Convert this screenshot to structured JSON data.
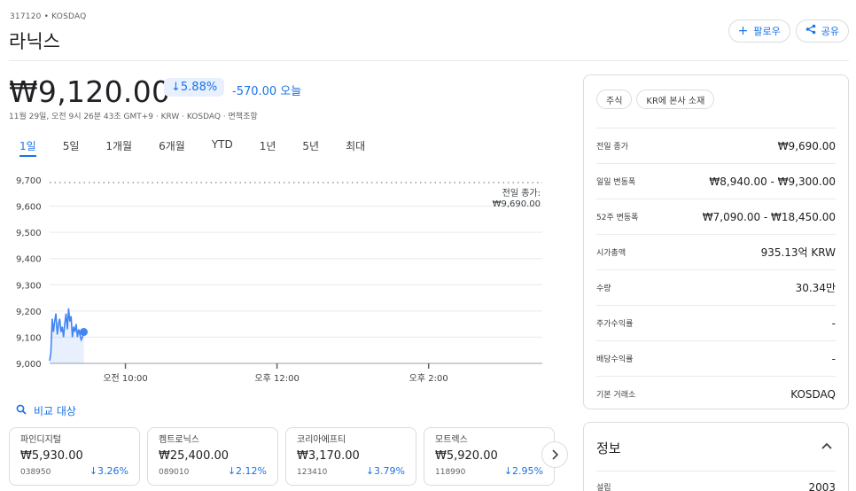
{
  "header": {
    "ticker_line": "317120 • KOSDAQ",
    "company": "라닉스",
    "follow_label": "팔로우",
    "share_label": "공유"
  },
  "quote": {
    "price": "₩9,120.00",
    "change_pct": "↓5.88%",
    "change_abs": "-570.00 오늘",
    "timestamp": "11월 29일, 오전 9시 26분 43초 GMT+9 · KRW · KOSDAQ · 면책조항"
  },
  "ranges": [
    "1일",
    "5일",
    "1개월",
    "6개월",
    "YTD",
    "1년",
    "5년",
    "최대"
  ],
  "active_range": "1일",
  "chart_data": {
    "type": "line",
    "ylim": [
      9000,
      9700
    ],
    "ytick_labels": [
      "9,700",
      "9,600",
      "9,500",
      "9,400",
      "9,300",
      "9,200",
      "9,100",
      "9,000"
    ],
    "ytick_values": [
      9700,
      9600,
      9500,
      9400,
      9300,
      9200,
      9100,
      9000
    ],
    "xtick_labels": [
      "오전 10:00",
      "오후 12:00",
      "오후 2:00"
    ],
    "xtick_minutes": [
      600,
      720,
      840
    ],
    "xlim_minutes": [
      540,
      930
    ],
    "prev_close": 9690,
    "prev_close_label": "전일 종가:",
    "prev_close_value": "₩9,690.00",
    "series": [
      {
        "x": [
          540,
          541,
          542,
          543,
          544,
          545,
          546,
          547,
          548,
          549,
          550,
          551,
          552,
          553,
          554,
          555,
          556,
          557,
          558,
          559,
          560,
          561,
          562,
          563,
          564,
          565,
          566,
          567
        ],
        "y": [
          9010,
          9040,
          9170,
          9120,
          9160,
          9190,
          9110,
          9150,
          9170,
          9120,
          9140,
          9100,
          9150,
          9190,
          9130,
          9210,
          9160,
          9180,
          9100,
          9140,
          9120,
          9150,
          9100,
          9130,
          9110,
          9090,
          9100,
          9120
        ]
      }
    ],
    "colors": {
      "line": "#4285f4",
      "grid": "#e8eaed",
      "prev_close": "#5f6368"
    }
  },
  "compare": {
    "label": "비교 대상"
  },
  "cards": [
    {
      "name": "파인디지털",
      "price": "₩5,930.00",
      "code": "038950",
      "pct": "↓3.26%"
    },
    {
      "name": "켐트로닉스",
      "price": "₩25,400.00",
      "code": "089010",
      "pct": "↓2.12%"
    },
    {
      "name": "코리아에프티",
      "price": "₩3,170.00",
      "code": "123410",
      "pct": "↓3.79%"
    },
    {
      "name": "모트렉스",
      "price": "₩5,920.00",
      "code": "118990",
      "pct": "↓2.95%"
    }
  ],
  "tags": [
    "주식",
    "KR에 본사 소재"
  ],
  "stats": [
    {
      "label": "전일 종가",
      "value": "₩9,690.00"
    },
    {
      "label": "일일 변동폭",
      "value": "₩8,940.00 - ₩9,300.00"
    },
    {
      "label": "52주 변동폭",
      "value": "₩7,090.00 - ₩18,450.00"
    },
    {
      "label": "시가총액",
      "value": "935.13억 KRW"
    },
    {
      "label": "수량",
      "value": "30.34만"
    },
    {
      "label": "주가수익률",
      "value": "-"
    },
    {
      "label": "배당수익률",
      "value": "-"
    },
    {
      "label": "기본 거래소",
      "value": "KOSDAQ"
    }
  ],
  "info": {
    "title": "정보",
    "row_label": "설립",
    "row_value": "2003"
  }
}
